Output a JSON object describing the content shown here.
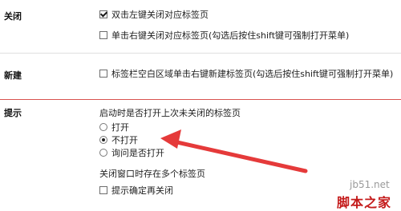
{
  "colors": {
    "divider_gray": "#e0e0e0",
    "divider_red": "#d9534f",
    "arrow": "#e53a3a",
    "watermark_red": "#c41a1a"
  },
  "close": {
    "label": "关闭",
    "opt1": {
      "text": "双击左键关闭对应标签页",
      "checked": true
    },
    "opt2": {
      "text": "单击右键关闭对应标签页(勾选后按住shift键可强制打开菜单)",
      "checked": false
    }
  },
  "new": {
    "label": "新建",
    "opt1": {
      "text": "标签栏空白区域单击右键新建标签页(勾选后按住shift键可强制打开菜单)",
      "checked": false
    }
  },
  "tips": {
    "label": "提示",
    "startup_title": "启动时是否打开上次未关闭的标签页",
    "radio_open": "打开",
    "radio_not_open": "不打开",
    "radio_ask": "询问是否打开",
    "selected": "radio_not_open",
    "multi_title": "关闭窗口时存在多个标签页",
    "confirm_close": {
      "text": "提示确定再关闭",
      "checked": false
    }
  },
  "watermark": {
    "site": "jb51.net",
    "brand": "脚本之家"
  }
}
